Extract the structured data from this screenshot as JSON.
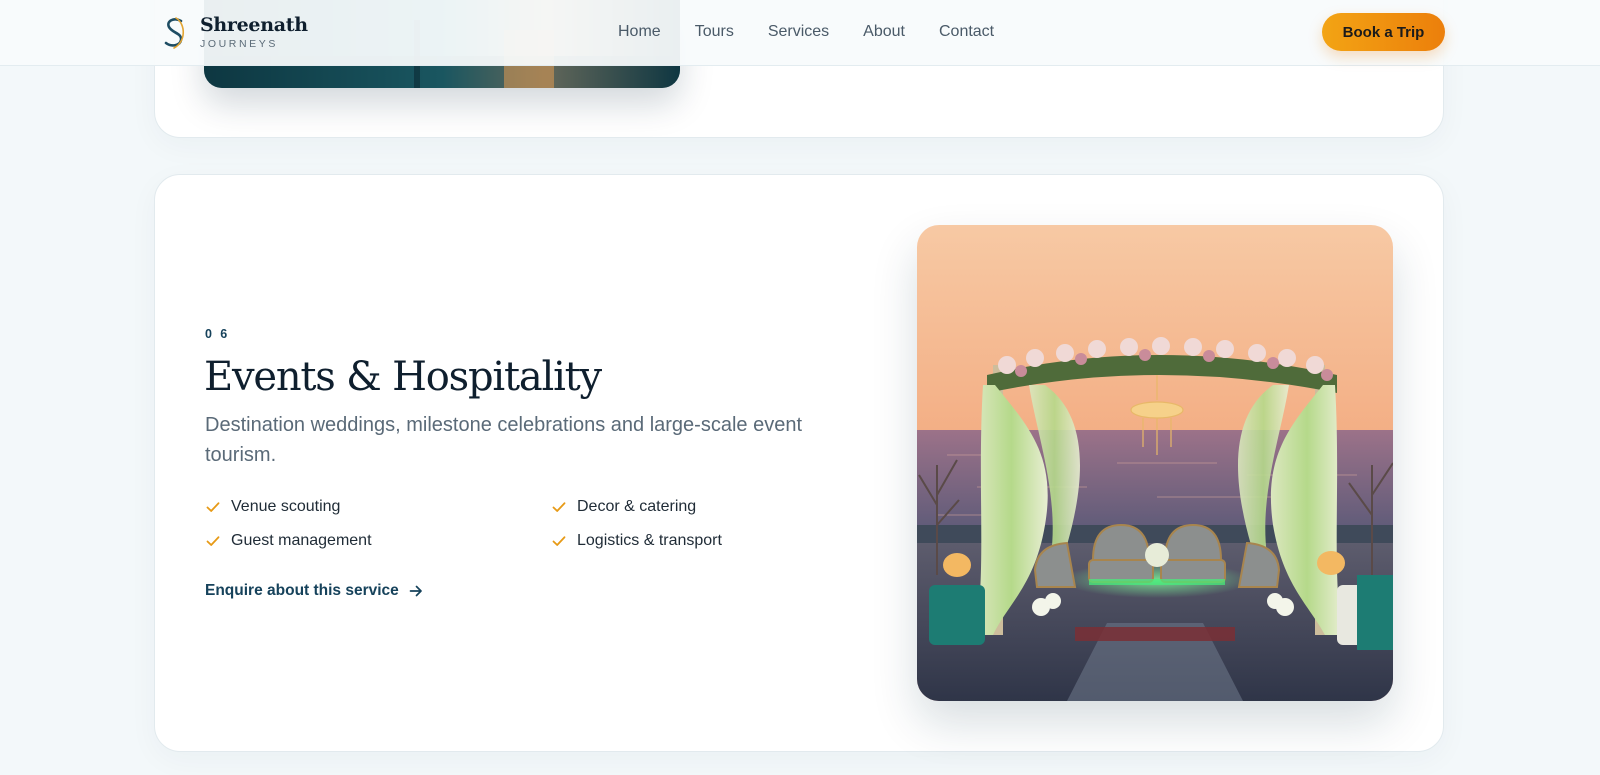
{
  "brand": {
    "name": "Shreenath",
    "tagline": "JOURNEYS"
  },
  "nav": {
    "items": [
      "Home",
      "Tours",
      "Services",
      "About",
      "Contact"
    ],
    "cta_label": "Book a Trip"
  },
  "service": {
    "number": "0 6",
    "title": "Events & Hospitality",
    "description": "Destination weddings, milestone celebrations and large-scale event tourism.",
    "features": [
      "Venue scouting",
      "Decor & catering",
      "Guest management",
      "Logistics & transport"
    ],
    "cta_label": "Enquire about this service"
  },
  "colors": {
    "accent_orange": "#ec7f0b",
    "brand_teal": "#16425b",
    "check_color": "#e79a16"
  },
  "icons": {
    "logo": "s-monogram-logo",
    "feature": "check-icon",
    "cta": "arrow-right-icon"
  }
}
